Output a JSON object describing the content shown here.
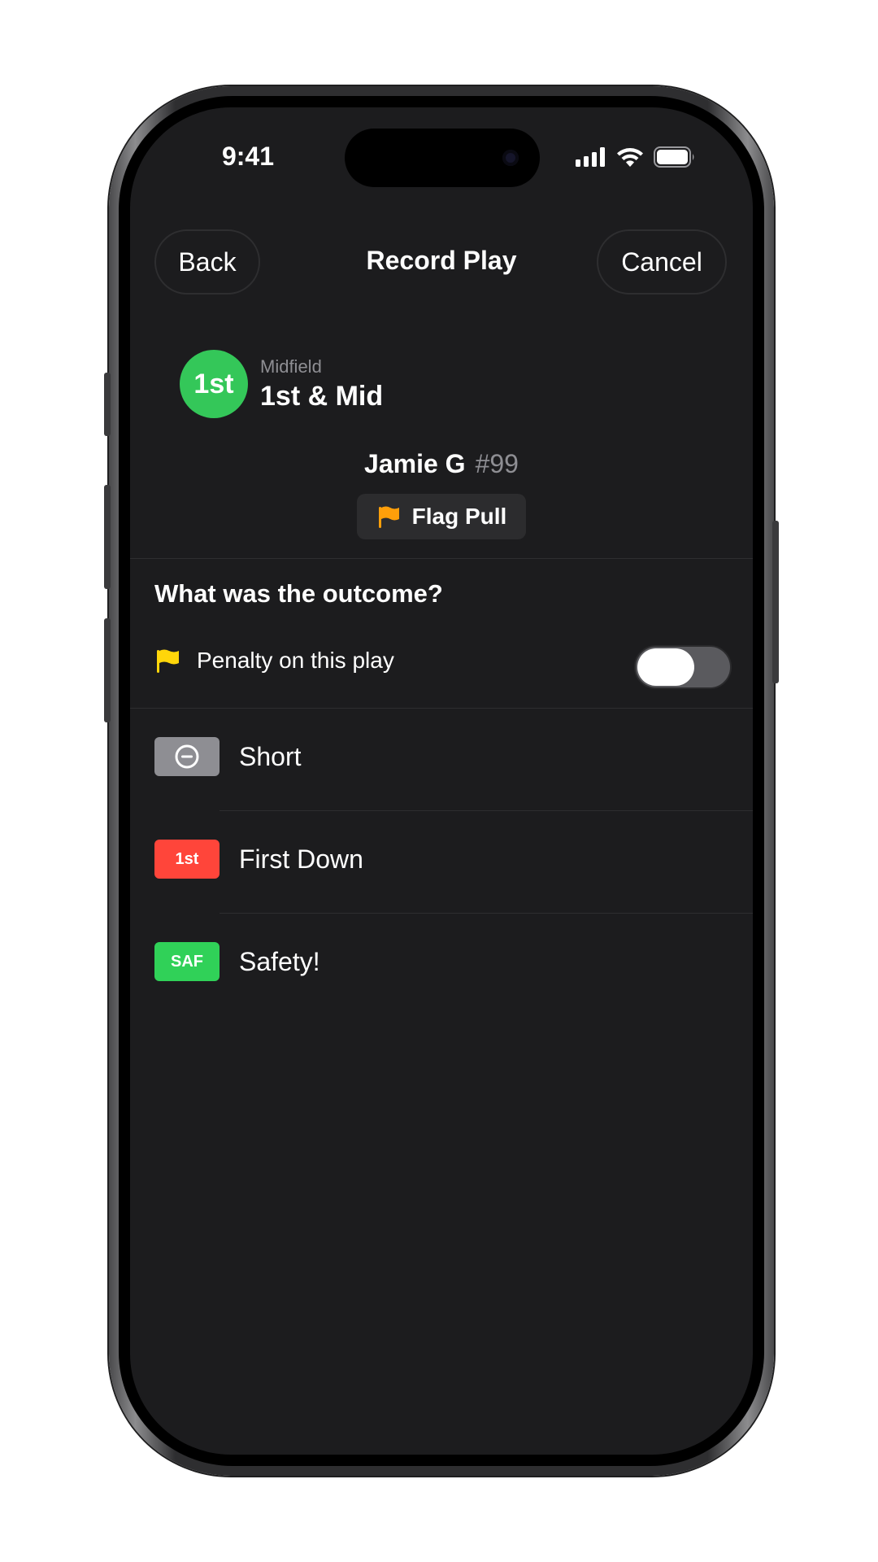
{
  "status_bar": {
    "time": "9:41"
  },
  "nav": {
    "back_label": "Back",
    "title": "Record Play",
    "cancel_label": "Cancel"
  },
  "down_info": {
    "badge": "1st",
    "location": "Midfield",
    "situation": "1st & Mid"
  },
  "player": {
    "name": "Jamie G",
    "number": "#99",
    "play_type": "Flag Pull",
    "play_icon": "orange-flag-icon"
  },
  "outcome": {
    "question": "What was the outcome?",
    "penalty_label": "Penalty on this play",
    "penalty_icon": "yellow-flag-icon",
    "penalty_enabled": false,
    "options": [
      {
        "label": "Short",
        "badge": "",
        "icon": "minus-circle-icon",
        "color": "#8e8e93"
      },
      {
        "label": "First Down",
        "badge": "1st",
        "color": "#ff453a"
      },
      {
        "label": "Safety!",
        "badge": "SAF",
        "color": "#30d158"
      }
    ]
  },
  "colors": {
    "background": "#1c1c1e",
    "accent_green": "#34c759",
    "flag_orange": "#ff9f0a",
    "flag_yellow": "#ffd60a"
  }
}
